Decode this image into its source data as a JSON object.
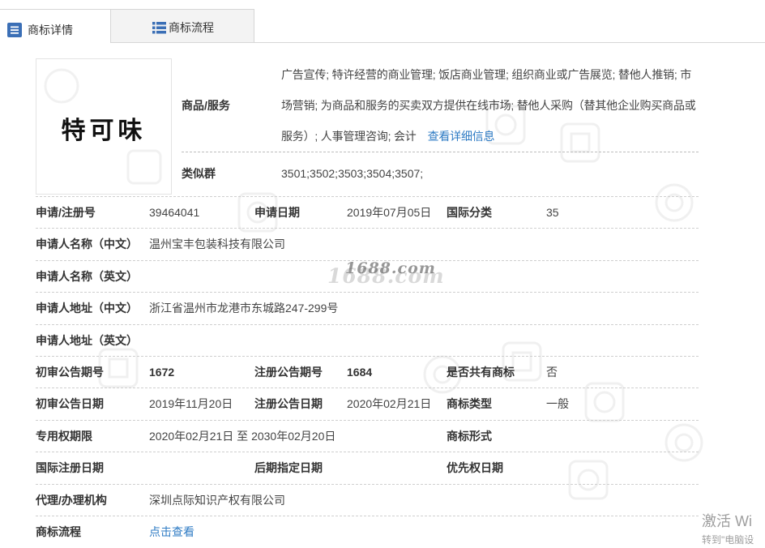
{
  "tabs": [
    {
      "label": "商标详情",
      "icon": "document-icon",
      "active": true
    },
    {
      "label": "商标流程",
      "icon": "list-icon",
      "active": false
    }
  ],
  "trademark": {
    "image_text": "特可味",
    "goods_services": {
      "label": "商品/服务",
      "lines": [
        "广告宣传; 特许经营的商业管理; 饭店商业管理; 组织商业或广告展览; 替他人推销; 市",
        "场营销; 为商品和服务的买卖双方提供在线市场; 替他人采购（替其他企业购买商品或",
        "服务）; 人事管理咨询; 会计"
      ],
      "detail_link": "查看详细信息"
    },
    "similar_group": {
      "label": "类似群",
      "value": "3501;3502;3503;3504;3507;"
    }
  },
  "rows": [
    {
      "cells": [
        {
          "label": "申请/注册号",
          "value": "39464041"
        },
        {
          "label": "申请日期",
          "value": "2019年07月05日"
        },
        {
          "label": "国际分类",
          "value": "35"
        }
      ]
    },
    {
      "cells": [
        {
          "label": "申请人名称（中文）",
          "value": "温州宝丰包装科技有限公司"
        }
      ]
    },
    {
      "cells": [
        {
          "label": "申请人名称（英文）"
        }
      ]
    },
    {
      "cells": [
        {
          "label": "申请人地址（中文）",
          "value": "浙江省温州市龙港市东城路247-299号"
        }
      ]
    },
    {
      "cells": [
        {
          "label": "申请人地址（英文）"
        }
      ]
    },
    {
      "cells": [
        {
          "label": "初审公告期号",
          "value": "1672"
        },
        {
          "label": "注册公告期号",
          "value": "1684"
        },
        {
          "label": "是否共有商标",
          "value": "否"
        }
      ]
    },
    {
      "cells": [
        {
          "label": "初审公告日期",
          "value": "2019年11月20日"
        },
        {
          "label": "注册公告日期",
          "value": "2020年02月21日"
        },
        {
          "label": "商标类型",
          "value": "一般"
        }
      ]
    },
    {
      "cells": [
        {
          "label": "专用权期限",
          "value": "2020年02月21日 至 2030年02月20日"
        },
        {
          "label": "商标形式"
        }
      ]
    },
    {
      "cells": [
        {
          "label": "国际注册日期"
        },
        {
          "label": "后期指定日期"
        },
        {
          "label": "优先权日期"
        }
      ]
    },
    {
      "cells": [
        {
          "label": "代理/办理机构",
          "value": "深圳点际知识产权有限公司"
        }
      ]
    },
    {
      "cells": [
        {
          "label": "商标流程",
          "link": "点击查看"
        }
      ]
    }
  ],
  "watermark": {
    "text": "1688.com"
  },
  "os_notice": {
    "line1": "激活 Wi",
    "line2": "转到\"电脑设"
  },
  "colors": {
    "tab_icon": "#3b6fb6",
    "link": "#2e7bc4",
    "label": "#333333",
    "value": "#444444",
    "divider": "#cfcfcf",
    "inactive_tab_bg": "#f3f3f3"
  }
}
